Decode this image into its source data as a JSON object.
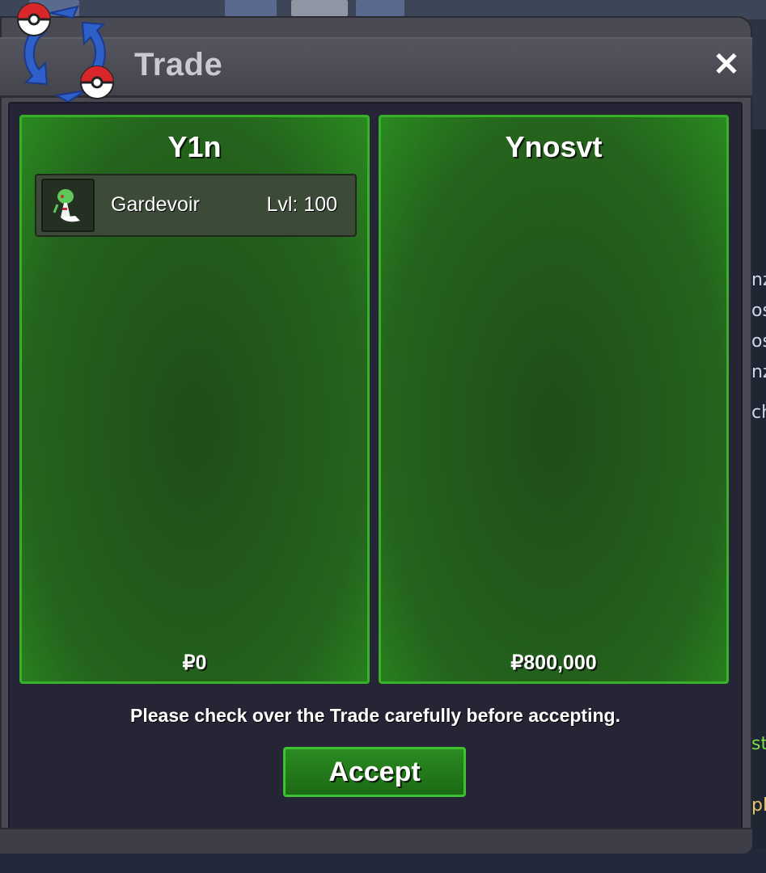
{
  "window": {
    "title": "Trade",
    "close_label": "✕"
  },
  "left_panel": {
    "player_name": "Y1n",
    "items": [
      {
        "name": "Gardevoir",
        "level": "Lvl: 100"
      }
    ],
    "money": "₽0"
  },
  "right_panel": {
    "player_name": "Ynosvt",
    "money": "₽800,000"
  },
  "notice": "Please check over the Trade carefully before accepting.",
  "accept_label": "Accept",
  "background_text": [
    "nz",
    "os",
    "os",
    "nz",
    "ch",
    "st",
    "pla"
  ],
  "icons": {
    "logo": "trade-arrows-pokeball-icon",
    "pokemon": "gardevoir-icon"
  },
  "colors": {
    "panel_border": "#37b02a",
    "panel_fill": "#24641d",
    "window": "#4a4a55",
    "title_text": "#c9c9cf"
  }
}
